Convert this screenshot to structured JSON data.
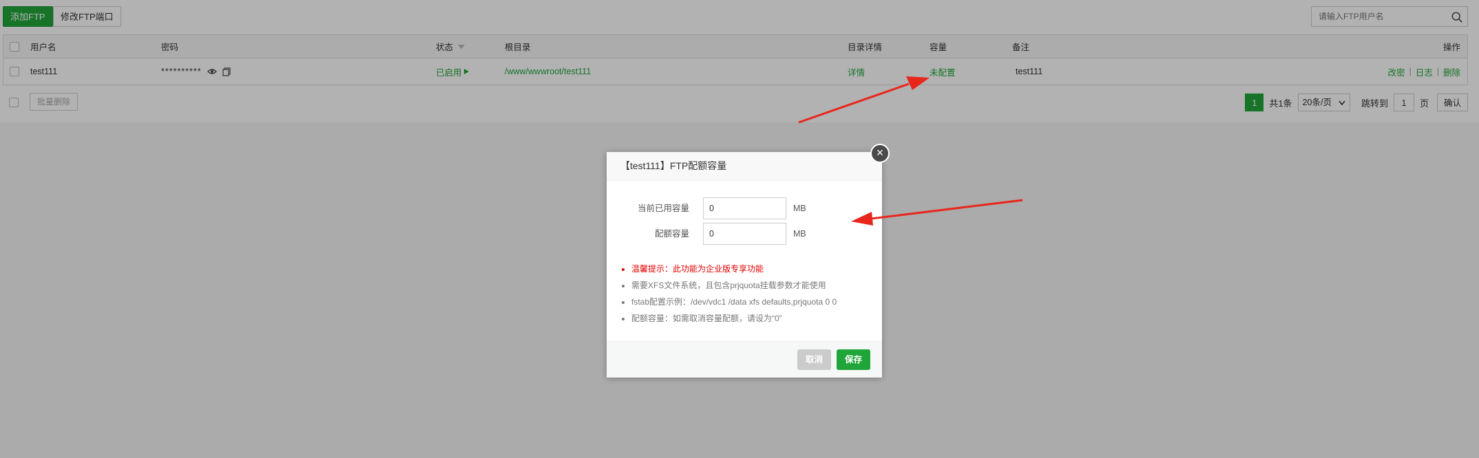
{
  "toolbar": {
    "add_ftp": "添加FTP",
    "modify_port": "修改FTP端口"
  },
  "search": {
    "placeholder": "请输入FTP用户名",
    "icon": "search-icon"
  },
  "table": {
    "headers": {
      "username": "用户名",
      "password": "密码",
      "status": "状态",
      "root": "根目录",
      "dir_detail": "目录详情",
      "capacity": "容量",
      "note": "备注",
      "actions": "操作"
    },
    "rows": [
      {
        "username": "test111",
        "password": "**********",
        "status": "已启用",
        "root": "/www/wwwroot/test111",
        "detail": "详情",
        "capacity": "未配置",
        "note": "test111",
        "action_edit": "改密",
        "action_log": "日志",
        "action_delete": "删除"
      }
    ]
  },
  "footer": {
    "batch_delete": "批量删除",
    "current_page": "1",
    "total": "共1条",
    "page_size": "20条/页",
    "jump_label": "跳转到",
    "jump_value": "1",
    "page_unit": "页",
    "confirm": "确认"
  },
  "modal": {
    "title": "【test111】FTP配额容量",
    "close": "×",
    "used_label": "当前已用容量",
    "used_value": "0",
    "quota_label": "配额容量",
    "quota_value": "0",
    "unit": "MB",
    "tips": [
      "温馨提示：此功能为企业版专享功能",
      "需要XFS文件系统，且包含prjquota挂载参数才能使用",
      "fstab配置示例：/dev/vdc1 /data xfs defaults,prjquota 0 0",
      "配额容量：如需取消容量配额，请设为“0”"
    ],
    "cancel": "取消",
    "save": "保存"
  },
  "colors": {
    "accent": "#20a53a",
    "warning": "#e30000",
    "annotation_arrow": "#e8261c"
  }
}
